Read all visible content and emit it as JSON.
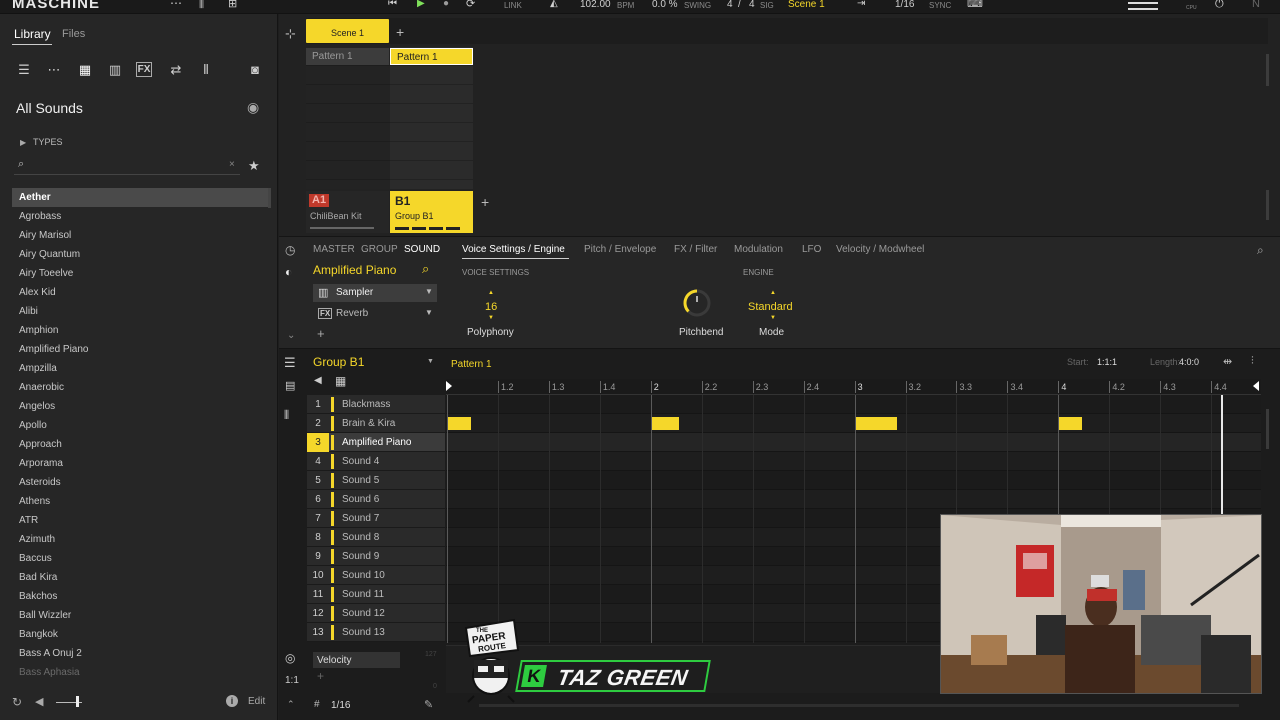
{
  "topbar": {
    "logo": "MASCHINE",
    "bpm_value": "102.00",
    "bpm_label": "BPM",
    "swing_value": "0.0 %",
    "swing_label": "SWING",
    "sig_num": "4",
    "sig_sep": "/",
    "sig_den": "4",
    "sig_label": "SIG",
    "link_label": "LINK",
    "scene": "Scene 1",
    "quant": "1/16",
    "sync_label": "SYNC",
    "cpu_label": "CPU"
  },
  "library": {
    "tabs": [
      "Library",
      "Files"
    ],
    "heading": "All Sounds",
    "types_label": "TYPES",
    "search_placeholder": "",
    "sounds": [
      "Aether",
      "Agrobass",
      "Airy Marisol",
      "Airy Quantum",
      "Airy Toeelve",
      "Alex Kid",
      "Alibi",
      "Amphion",
      "Amplified Piano",
      "Ampzilla",
      "Anaerobic",
      "Angelos",
      "Apollo",
      "Approach",
      "Arporama",
      "Asteroids",
      "Athens",
      "ATR",
      "Azimuth",
      "Baccus",
      "Bad Kira",
      "Bakchos",
      "Ball Wizzler",
      "Bangkok",
      "Bass A Onuj 2",
      "Bass Aphasia"
    ],
    "selected_index": 0,
    "edit_label": "Edit"
  },
  "arranger": {
    "scene_label": "Scene 1",
    "patterns": [
      "Pattern 1",
      "Pattern 1"
    ],
    "group_a_code": "A1",
    "group_a_name": "ChiliBean Kit",
    "group_b_code": "B1",
    "group_b_name": "Group B1"
  },
  "soundpanel": {
    "tabs_left": [
      "MASTER",
      "GROUP",
      "SOUND"
    ],
    "sound_name": "Amplified Piano",
    "plugins": [
      "Sampler",
      "Reverb"
    ],
    "param_tabs": [
      "Voice Settings / Engine",
      "Pitch / Envelope",
      "FX / Filter",
      "Modulation",
      "LFO",
      "Velocity / Modwheel"
    ],
    "section_voice": "VOICE SETTINGS",
    "section_engine": "ENGINE",
    "polyphony_value": "16",
    "polyphony_label": "Polyphony",
    "pitchbend_label": "Pitchbend",
    "pitchbend_level": 0.5,
    "mode_value": "Standard",
    "mode_label": "Mode"
  },
  "pattern": {
    "group_name": "Group B1",
    "pattern_name": "Pattern 1",
    "start_label": "Start:",
    "start_value": "1:1:1",
    "length_label": "Length:",
    "length_value": "4:0:0",
    "ruler": [
      "1.2",
      "1.3",
      "1.4",
      "2",
      "2.2",
      "2.3",
      "2.4",
      "3",
      "3.2",
      "3.3",
      "3.4",
      "4",
      "4.2",
      "4.3",
      "4.4"
    ],
    "sounds": [
      "Blackmass",
      "Brain & Kira",
      "Amplified Piano",
      "Sound 4",
      "Sound 5",
      "Sound 6",
      "Sound 7",
      "Sound 8",
      "Sound 9",
      "Sound 10",
      "Sound 11",
      "Sound 12",
      "Sound 13"
    ],
    "selected_sound": 2,
    "notes": [
      {
        "row": 1,
        "beat": 1.0,
        "len": 0.25
      },
      {
        "row": 1,
        "beat": 2.0,
        "len": 0.3
      },
      {
        "row": 1,
        "beat": 3.0,
        "len": 0.45
      },
      {
        "row": 1,
        "beat": 4.0,
        "len": 0.25
      }
    ],
    "velocity_label": "Velocity",
    "quant_label": "1/16",
    "velocity_max": "127",
    "velocity_min": "0"
  },
  "overlay": {
    "badge_line1": "THE",
    "badge_line2": "PAPER",
    "badge_line3": "ROUTE",
    "banner_k": "K",
    "banner_name": "TAZ GREEN"
  },
  "colors": {
    "accent": "#f5d72a",
    "group_a": "#c0392b",
    "banner": "#1e1e1e",
    "banner_green": "#2ecc40"
  }
}
